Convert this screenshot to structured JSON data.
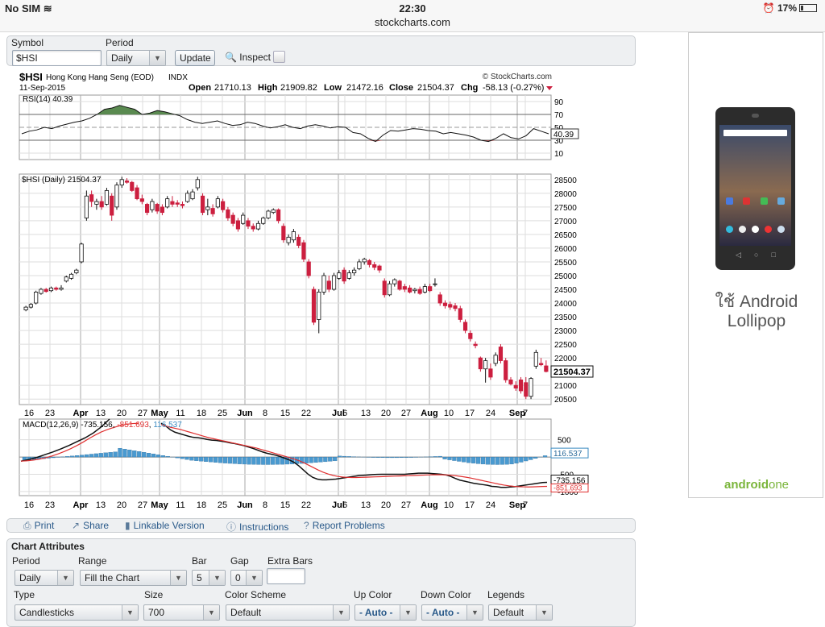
{
  "status_bar": {
    "carrier": "No SIM",
    "time": "22:30",
    "url": "stockcharts.com",
    "battery": "17%"
  },
  "symbol_bar": {
    "symbol_label": "Symbol",
    "symbol_value": "$HSI",
    "period_label": "Period",
    "period_value": "Daily",
    "update_label": "Update",
    "inspect_label": "Inspect"
  },
  "chart_header": {
    "symbol": "$HSI",
    "name": "Hong Kong Hang Seng (EOD)",
    "exchange": "INDX",
    "date": "11-Sep-2015",
    "brand": "© StockCharts.com",
    "open_label": "Open",
    "open": "21710.13",
    "high_label": "High",
    "high": "21909.82",
    "low_label": "Low",
    "low": "21472.16",
    "close_label": "Close",
    "close": "21504.37",
    "chg_label": "Chg",
    "chg": "-58.13 (-0.27%)"
  },
  "colors": {
    "up": "#ffffff",
    "down": "#cc1f3f",
    "rsi_fill_up": "#5a8a50",
    "rsi_fill_down": "#a05050",
    "macd": "#111111",
    "signal": "#e03030",
    "hist": "#4a9ad0",
    "grid": "#dddddd",
    "accent": "#2a5a8a"
  },
  "chart_data": [
    {
      "type": "line",
      "title": "RSI(14) 40.39",
      "label": "RSI(14)",
      "last_value": "40.39",
      "y_ticks": [
        90,
        70,
        50,
        30,
        10
      ],
      "ylim": [
        0,
        100
      ],
      "values": [
        40,
        44,
        46,
        50,
        48,
        52,
        55,
        58,
        60,
        64,
        70,
        78,
        80,
        84,
        81,
        78,
        70,
        72,
        76,
        74,
        71,
        68,
        62,
        58,
        56,
        58,
        60,
        56,
        53,
        54,
        58,
        56,
        52,
        49,
        51,
        54,
        50,
        48,
        52,
        54,
        52,
        49,
        51,
        50,
        42,
        40,
        33,
        28,
        38,
        45,
        44,
        46,
        48,
        47,
        45,
        44,
        40,
        42,
        40,
        38,
        35,
        30,
        28,
        33,
        40,
        34,
        32,
        37,
        48,
        44,
        40
      ]
    },
    {
      "type": "candlestick",
      "title": "$HSI (Daily) 21504.37",
      "label": "$HSI (Daily)",
      "last_value": "21504.37",
      "ylim": [
        20300,
        28700
      ],
      "y_ticks": [
        28500,
        28000,
        27500,
        27000,
        26500,
        26000,
        25500,
        25000,
        24500,
        24000,
        23500,
        23000,
        22500,
        22000,
        21000,
        20500
      ],
      "x_ticks": [
        "16",
        "23",
        "Apr",
        "13",
        "20",
        "27",
        "May",
        "11",
        "18",
        "25",
        "Jun",
        "8",
        "15",
        "22",
        "Jul",
        "6",
        "13",
        "20",
        "27",
        "Aug",
        "10",
        "17",
        "24",
        "Sep",
        "7"
      ],
      "values": [
        {
          "o": 23750,
          "h": 23900,
          "l": 23700,
          "c": 23850
        },
        {
          "o": 23850,
          "h": 24000,
          "l": 23800,
          "c": 23950
        },
        {
          "o": 24000,
          "h": 24450,
          "l": 23950,
          "c": 24400
        },
        {
          "o": 24350,
          "h": 24550,
          "l": 24300,
          "c": 24500
        },
        {
          "o": 24500,
          "h": 24550,
          "l": 24380,
          "c": 24420
        },
        {
          "o": 24450,
          "h": 24600,
          "l": 24400,
          "c": 24550
        },
        {
          "o": 24550,
          "h": 24600,
          "l": 24450,
          "c": 24500
        },
        {
          "o": 24500,
          "h": 24650,
          "l": 24450,
          "c": 24550
        },
        {
          "o": 24800,
          "h": 25000,
          "l": 24750,
          "c": 24950
        },
        {
          "o": 24900,
          "h": 25100,
          "l": 24850,
          "c": 25050
        },
        {
          "o": 25100,
          "h": 25250,
          "l": 25050,
          "c": 25200
        },
        {
          "o": 25500,
          "h": 26200,
          "l": 25450,
          "c": 26150
        },
        {
          "o": 27100,
          "h": 28100,
          "l": 27000,
          "c": 27900
        },
        {
          "o": 27950,
          "h": 28100,
          "l": 27500,
          "c": 27700
        },
        {
          "o": 27600,
          "h": 27800,
          "l": 27400,
          "c": 27700
        },
        {
          "o": 27700,
          "h": 27900,
          "l": 27400,
          "c": 27500
        },
        {
          "o": 27600,
          "h": 28200,
          "l": 27550,
          "c": 28100
        },
        {
          "o": 27900,
          "h": 28000,
          "l": 27000,
          "c": 27200
        },
        {
          "o": 27500,
          "h": 28400,
          "l": 27400,
          "c": 28300
        },
        {
          "o": 28300,
          "h": 28600,
          "l": 28200,
          "c": 28500
        },
        {
          "o": 28450,
          "h": 28550,
          "l": 28350,
          "c": 28400
        },
        {
          "o": 28400,
          "h": 28450,
          "l": 28050,
          "c": 28100
        },
        {
          "o": 28200,
          "h": 28300,
          "l": 27750,
          "c": 27800
        },
        {
          "o": 27800,
          "h": 27950,
          "l": 27600,
          "c": 27700
        },
        {
          "o": 27600,
          "h": 27650,
          "l": 27200,
          "c": 27300
        },
        {
          "o": 27400,
          "h": 27800,
          "l": 27300,
          "c": 27700
        },
        {
          "o": 27600,
          "h": 27650,
          "l": 27250,
          "c": 27350
        },
        {
          "o": 27500,
          "h": 27600,
          "l": 27200,
          "c": 27300
        },
        {
          "o": 27500,
          "h": 27900,
          "l": 27450,
          "c": 27800
        },
        {
          "o": 27700,
          "h": 27900,
          "l": 27500,
          "c": 27600
        },
        {
          "o": 27650,
          "h": 27750,
          "l": 27500,
          "c": 27600
        },
        {
          "o": 27600,
          "h": 27700,
          "l": 27450,
          "c": 27550
        },
        {
          "o": 27700,
          "h": 28100,
          "l": 27650,
          "c": 28000
        },
        {
          "o": 27800,
          "h": 28150,
          "l": 27750,
          "c": 28050
        },
        {
          "o": 28200,
          "h": 28600,
          "l": 28100,
          "c": 28500
        },
        {
          "o": 27900,
          "h": 28000,
          "l": 27200,
          "c": 27300
        },
        {
          "o": 27400,
          "h": 27800,
          "l": 27200,
          "c": 27500
        },
        {
          "o": 27450,
          "h": 27600,
          "l": 27150,
          "c": 27250
        },
        {
          "o": 27500,
          "h": 27900,
          "l": 27450,
          "c": 27800
        },
        {
          "o": 27700,
          "h": 27800,
          "l": 27300,
          "c": 27400
        },
        {
          "o": 27400,
          "h": 27500,
          "l": 27000,
          "c": 27100
        },
        {
          "o": 27200,
          "h": 27300,
          "l": 26800,
          "c": 26900
        },
        {
          "o": 27000,
          "h": 27100,
          "l": 26600,
          "c": 26700
        },
        {
          "o": 26900,
          "h": 27300,
          "l": 26850,
          "c": 27200
        },
        {
          "o": 27000,
          "h": 27100,
          "l": 26700,
          "c": 26800
        },
        {
          "o": 26800,
          "h": 26900,
          "l": 26600,
          "c": 26700
        },
        {
          "o": 26700,
          "h": 27000,
          "l": 26650,
          "c": 26900
        },
        {
          "o": 26900,
          "h": 27150,
          "l": 26850,
          "c": 27100
        },
        {
          "o": 27100,
          "h": 27400,
          "l": 27050,
          "c": 27350
        },
        {
          "o": 27300,
          "h": 27450,
          "l": 27250,
          "c": 27400
        },
        {
          "o": 27400,
          "h": 27450,
          "l": 26900,
          "c": 27000
        },
        {
          "o": 26800,
          "h": 26900,
          "l": 26200,
          "c": 26300
        },
        {
          "o": 26200,
          "h": 26500,
          "l": 26100,
          "c": 26400
        },
        {
          "o": 26300,
          "h": 26700,
          "l": 26200,
          "c": 26600
        },
        {
          "o": 26400,
          "h": 26500,
          "l": 26000,
          "c": 26100
        },
        {
          "o": 26200,
          "h": 26300,
          "l": 25500,
          "c": 25600
        },
        {
          "o": 25500,
          "h": 25600,
          "l": 24900,
          "c": 25000
        },
        {
          "o": 24500,
          "h": 24600,
          "l": 23200,
          "c": 23300
        },
        {
          "o": 23400,
          "h": 24500,
          "l": 22900,
          "c": 24400
        },
        {
          "o": 24400,
          "h": 25100,
          "l": 24300,
          "c": 25000
        },
        {
          "o": 24800,
          "h": 25000,
          "l": 24400,
          "c": 24500
        },
        {
          "o": 24500,
          "h": 25100,
          "l": 24450,
          "c": 25000
        },
        {
          "o": 24900,
          "h": 25200,
          "l": 24850,
          "c": 25100
        },
        {
          "o": 25200,
          "h": 25300,
          "l": 24700,
          "c": 24800
        },
        {
          "o": 24900,
          "h": 25200,
          "l": 24850,
          "c": 25100
        },
        {
          "o": 25100,
          "h": 25300,
          "l": 25000,
          "c": 25200
        },
        {
          "o": 25250,
          "h": 25600,
          "l": 25200,
          "c": 25500
        },
        {
          "o": 25500,
          "h": 25650,
          "l": 25400,
          "c": 25600
        },
        {
          "o": 25550,
          "h": 25600,
          "l": 25300,
          "c": 25400
        },
        {
          "o": 25400,
          "h": 25500,
          "l": 25200,
          "c": 25300
        },
        {
          "o": 25350,
          "h": 25400,
          "l": 25100,
          "c": 25200
        },
        {
          "o": 24800,
          "h": 24900,
          "l": 24200,
          "c": 24300
        },
        {
          "o": 24300,
          "h": 24800,
          "l": 24250,
          "c": 24700
        },
        {
          "o": 24700,
          "h": 24900,
          "l": 24600,
          "c": 24850
        },
        {
          "o": 24800,
          "h": 24850,
          "l": 24450,
          "c": 24500
        },
        {
          "o": 24600,
          "h": 24700,
          "l": 24400,
          "c": 24500
        },
        {
          "o": 24550,
          "h": 24650,
          "l": 24350,
          "c": 24400
        },
        {
          "o": 24450,
          "h": 24550,
          "l": 24350,
          "c": 24500
        },
        {
          "o": 24500,
          "h": 24600,
          "l": 24300,
          "c": 24350
        },
        {
          "o": 24400,
          "h": 24700,
          "l": 24350,
          "c": 24600
        },
        {
          "o": 24600,
          "h": 24700,
          "l": 24400,
          "c": 24450
        },
        {
          "o": 24700,
          "h": 24900,
          "l": 24600,
          "c": 24700
        },
        {
          "o": 24300,
          "h": 24400,
          "l": 23900,
          "c": 24000
        },
        {
          "o": 24000,
          "h": 24100,
          "l": 23800,
          "c": 23900
        },
        {
          "o": 23950,
          "h": 24050,
          "l": 23750,
          "c": 23850
        },
        {
          "o": 23900,
          "h": 24000,
          "l": 23700,
          "c": 23800
        },
        {
          "o": 23800,
          "h": 23900,
          "l": 23300,
          "c": 23400
        },
        {
          "o": 23300,
          "h": 23400,
          "l": 22900,
          "c": 23000
        },
        {
          "o": 22900,
          "h": 23000,
          "l": 22600,
          "c": 22700
        },
        {
          "o": 22500,
          "h": 22600,
          "l": 22350,
          "c": 22450
        },
        {
          "o": 22000,
          "h": 22050,
          "l": 21500,
          "c": 21600
        },
        {
          "o": 21600,
          "h": 22000,
          "l": 21100,
          "c": 21900
        },
        {
          "o": 21600,
          "h": 21800,
          "l": 21200,
          "c": 21300
        },
        {
          "o": 21800,
          "h": 22200,
          "l": 21700,
          "c": 22100
        },
        {
          "o": 22400,
          "h": 22500,
          "l": 21800,
          "c": 21900
        },
        {
          "o": 21900,
          "h": 22000,
          "l": 21100,
          "c": 21200
        },
        {
          "o": 21200,
          "h": 21300,
          "l": 21000,
          "c": 21050
        },
        {
          "o": 21000,
          "h": 21150,
          "l": 20800,
          "c": 20900
        },
        {
          "o": 21200,
          "h": 21300,
          "l": 20700,
          "c": 20800
        },
        {
          "o": 21100,
          "h": 21300,
          "l": 20500,
          "c": 20600
        },
        {
          "o": 20600,
          "h": 21300,
          "l": 20500,
          "c": 21250
        },
        {
          "o": 21700,
          "h": 22300,
          "l": 21600,
          "c": 22200
        },
        {
          "o": 21800,
          "h": 22000,
          "l": 21700,
          "c": 21750
        },
        {
          "o": 21710,
          "h": 21910,
          "l": 21472,
          "c": 21504
        }
      ]
    },
    {
      "type": "line",
      "title": "MACD(12,26,9) -735.156, -851.693, 116.537",
      "label": "MACD(12,26,9)",
      "macd": "-735.156",
      "signal": "-851.693",
      "hist": "116.537",
      "y_ticks": [
        500,
        -500,
        -1000
      ],
      "ylim": [
        -1120,
        1100
      ],
      "macd_values": [
        -120,
        -70,
        -10,
        70,
        150,
        240,
        340,
        450,
        560,
        700,
        880,
        1100
      ],
      "signal_values": [
        -120,
        -110,
        -90,
        -60,
        -20,
        30,
        90,
        160,
        240,
        330,
        430,
        540,
        640,
        730,
        800,
        860,
        910,
        950,
        970,
        980
      ],
      "macd_values_2": [
        980,
        900,
        790,
        720,
        680,
        640,
        600,
        570,
        560,
        540,
        510,
        490,
        480,
        460,
        440,
        410,
        390,
        360,
        330,
        290,
        250,
        200,
        150,
        110,
        80,
        50,
        10,
        -40,
        -90,
        -160,
        -260,
        -380,
        -500,
        -590,
        -640,
        -660,
        -660,
        -650,
        -640,
        -620,
        -600,
        -580,
        -560,
        -540,
        -530,
        -520,
        -510,
        -505,
        -500,
        -500,
        -500,
        -500,
        -500,
        -500,
        -490,
        -480,
        -470,
        -470,
        -470,
        -480,
        -490,
        -500,
        -520,
        -560,
        -620,
        -670,
        -700,
        -730,
        -760,
        -780,
        -800,
        -820,
        -850,
        -860,
        -880,
        -880,
        -870,
        -860,
        -840,
        -820,
        -800,
        -780,
        -760,
        -740,
        -735
      ],
      "signal_values_2": [
        940,
        900,
        860,
        830,
        800,
        760,
        720,
        680,
        640,
        600,
        560,
        530,
        500,
        470,
        440,
        410,
        380,
        350,
        320,
        290,
        260,
        220,
        180,
        140,
        100,
        60,
        20,
        -20,
        -60,
        -110,
        -170,
        -240,
        -310,
        -380,
        -440,
        -490,
        -530,
        -560,
        -580,
        -590,
        -595,
        -595,
        -590,
        -585,
        -580,
        -575,
        -570,
        -565,
        -560,
        -555,
        -550,
        -545,
        -540,
        -535,
        -530,
        -525,
        -520,
        -515,
        -512,
        -515,
        -520,
        -530,
        -545,
        -565,
        -585,
        -610,
        -640,
        -670,
        -700,
        -730,
        -760,
        -790,
        -815,
        -835,
        -850,
        -860,
        -865,
        -868,
        -865,
        -860,
        -855,
        -851
      ]
    },
    {
      "x_ticks": [
        "16",
        "23",
        "Apr",
        "13",
        "20",
        "27",
        "May",
        "11",
        "18",
        "25",
        "Jun",
        "8",
        "15",
        "22",
        "Jul",
        "6",
        "13",
        "20",
        "27",
        "Aug",
        "10",
        "17",
        "24",
        "Sep",
        "7"
      ]
    }
  ],
  "toolbar": {
    "print": "Print",
    "share": "Share",
    "linkable": "Linkable Version",
    "instructions": "Instructions",
    "report": "Report Problems"
  },
  "attributes": {
    "title": "Chart Attributes",
    "period_label": "Period",
    "period": "Daily",
    "range_label": "Range",
    "range": "Fill the Chart",
    "bar_label": "Bar",
    "bar": "5",
    "gap_label": "Gap",
    "gap": "0",
    "extra_label": "Extra Bars",
    "extra": "",
    "type_label": "Type",
    "type": "Candlesticks",
    "size_label": "Size",
    "size": "700",
    "scheme_label": "Color Scheme",
    "scheme": "Default",
    "up_label": "Up Color",
    "up": "- Auto -",
    "down_label": "Down Color",
    "down": "- Auto -",
    "legends_label": "Legends",
    "legends": "Default"
  },
  "ad": {
    "line1": "ใช้ Android",
    "line2": "Lollipop",
    "logo_a": "android",
    "logo_b": "one"
  }
}
